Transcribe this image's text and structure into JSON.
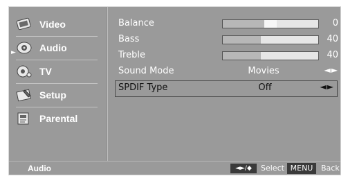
{
  "sidebar": {
    "items": [
      {
        "label": "Video",
        "icon": "video-icon"
      },
      {
        "label": "Audio",
        "icon": "audio-icon",
        "selected": true
      },
      {
        "label": "TV",
        "icon": "tv-icon"
      },
      {
        "label": "Setup",
        "icon": "setup-icon"
      },
      {
        "label": "Parental",
        "icon": "parental-icon"
      }
    ],
    "selected_marker": "►"
  },
  "settings": {
    "balance": {
      "label": "Balance",
      "value": "0",
      "level": 0.5
    },
    "bass": {
      "label": "Bass",
      "value": "40",
      "level": 0.4
    },
    "treble": {
      "label": "Treble",
      "value": "40",
      "level": 0.4
    },
    "sound_mode": {
      "label": "Sound Mode",
      "value": "Movies",
      "arrows": "◄►"
    },
    "spdif_type": {
      "label": "SPDIF Type",
      "value": "Off",
      "arrows": "◄►"
    }
  },
  "footer": {
    "title": "Audio",
    "nav_key": "◄►/◆",
    "select_label": "Select",
    "menu_key": "MENU",
    "back_label": "Back"
  },
  "colors": {
    "panel": "#9a9a9a",
    "text": "#ffffff",
    "selected_text": "#111111",
    "key_bg": "#3a3a3a"
  }
}
